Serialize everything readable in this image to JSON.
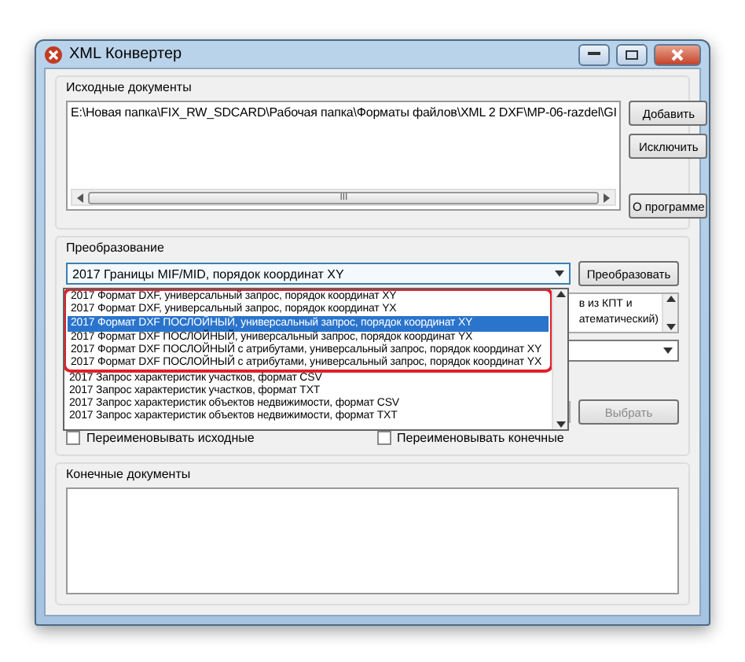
{
  "window": {
    "title": "XML Конвертер"
  },
  "source_group": {
    "label": "Исходные документы",
    "files": [
      "E:\\Новая папка\\FIX_RW_SDCARD\\Рабочая папка\\Форматы файлов\\XML 2 DXF\\MP-06-razdel\\GI"
    ],
    "buttons": [
      "Добавить",
      "Исключить",
      "О программе"
    ],
    "scroll_thumb": "III"
  },
  "conversion_group": {
    "label": "Преобразование",
    "format": "2017 Границы MIF/MID, порядок координат XY",
    "convert_button": "Преобразовать",
    "dropdown": {
      "expanded": true,
      "marked_items": [
        {
          "label": "2017 Формат DXF, универсальный запрос, порядок координат XY",
          "selected": false
        },
        {
          "label": "2017 Формат DXF, универсальный запрос, порядок координат YX",
          "selected": false
        },
        {
          "label": "2017 Формат DXF ПОСЛОЙНЫЙ, универсальный запрос, порядок координат XY",
          "selected": true
        },
        {
          "label": "2017 Формат DXF ПОСЛОЙНЫЙ, универсальный запрос, порядок координат YX",
          "selected": false
        },
        {
          "label": "2017 Формат DXF ПОСЛОЙНЫЙ с атрибутами, универсальный запрос, порядок координат XY",
          "selected": false
        },
        {
          "label": "2017 Формат DXF ПОСЛОЙНЫЙ с атрибутами, универсальный запрос, порядок координат YX",
          "selected": false
        }
      ],
      "items": [
        {
          "label": "2017 Запрос характеристик участков, формат CSV",
          "selected": false
        },
        {
          "label": "2017 Запрос характеристик участков, формат TXT",
          "selected": false
        },
        {
          "label": "2017 Запрос характеристик объектов недвижимости, формат CSV",
          "selected": false
        },
        {
          "label": "2017 Запрос характеристик объектов недвижимости, формат TXT",
          "selected": false
        }
      ]
    },
    "description_lines": [
      "в из КПТ и",
      "атематический)"
    ],
    "browse_button": "Выбрать",
    "checkboxes": [
      {
        "label": "Переименовывать исходные",
        "checked": false
      },
      {
        "label": "Переименовывать конечные",
        "checked": false
      }
    ]
  },
  "output_group": {
    "label": "Конечные документы"
  }
}
